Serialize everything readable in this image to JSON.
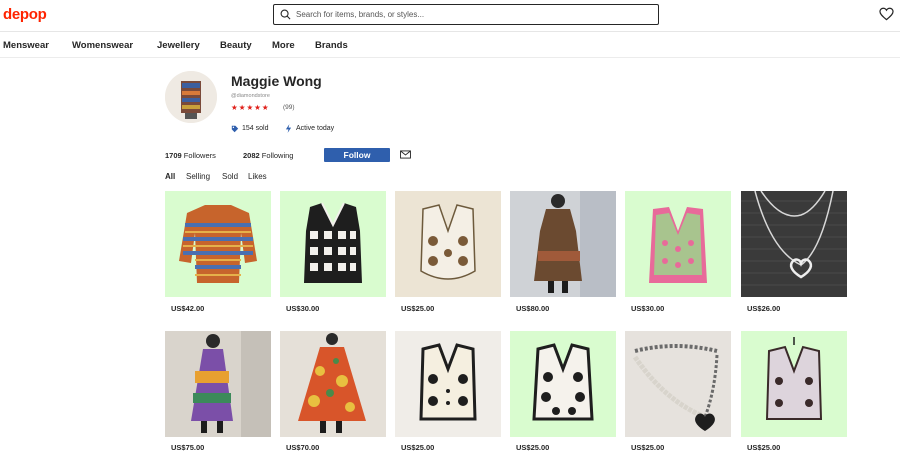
{
  "header": {
    "logo": "depop",
    "search_placeholder": "Search for items, brands, or styles...",
    "brand_color": "#ff2300"
  },
  "nav": {
    "items": [
      "Menswear",
      "Womenswear",
      "Jewellery",
      "Beauty",
      "More",
      "Brands"
    ]
  },
  "profile": {
    "name": "Maggie Wong",
    "handle": "@diamondstore",
    "stars": "★★★★★",
    "reviews": "(99)",
    "sold": "154 sold",
    "active": "Active today",
    "followers_count": "1709",
    "followers_label": "Followers",
    "following_count": "2082",
    "following_label": "Following",
    "follow_label": "Follow",
    "follow_color": "#2f5fad"
  },
  "tabs": [
    "All",
    "Selling",
    "Sold",
    "Likes"
  ],
  "products": [
    {
      "price": "US$42.00",
      "bg": "#d9fccf",
      "item": "orange-striped-sweater"
    },
    {
      "price": "US$30.00",
      "bg": "#d9fccf",
      "item": "black-white-knit-vest"
    },
    {
      "price": "US$25.00",
      "bg": "#ece4d4",
      "item": "cream-flower-vest"
    },
    {
      "price": "US$80.00",
      "bg": "#cfd2d6",
      "item": "brown-dress"
    },
    {
      "price": "US$30.00",
      "bg": "#d9fccf",
      "item": "pink-green-vest"
    },
    {
      "price": "US$26.00",
      "bg": "#3a3a3a",
      "item": "heart-necklace"
    },
    {
      "price": "US$75.00",
      "bg": "#d9d4cc",
      "item": "patchwork-dress"
    },
    {
      "price": "US$70.00",
      "bg": "#e5e0d8",
      "item": "orange-floral-skirt"
    },
    {
      "price": "US$25.00",
      "bg": "#f0ede8",
      "item": "cream-black-flower-cardigan"
    },
    {
      "price": "US$25.00",
      "bg": "#d9fccf",
      "item": "black-daisy-vest"
    },
    {
      "price": "US$25.00",
      "bg": "#e6e2dd",
      "item": "pearl-heart-necklace"
    },
    {
      "price": "US$25.00",
      "bg": "#d9fccf",
      "item": "lavender-flower-vest"
    }
  ]
}
